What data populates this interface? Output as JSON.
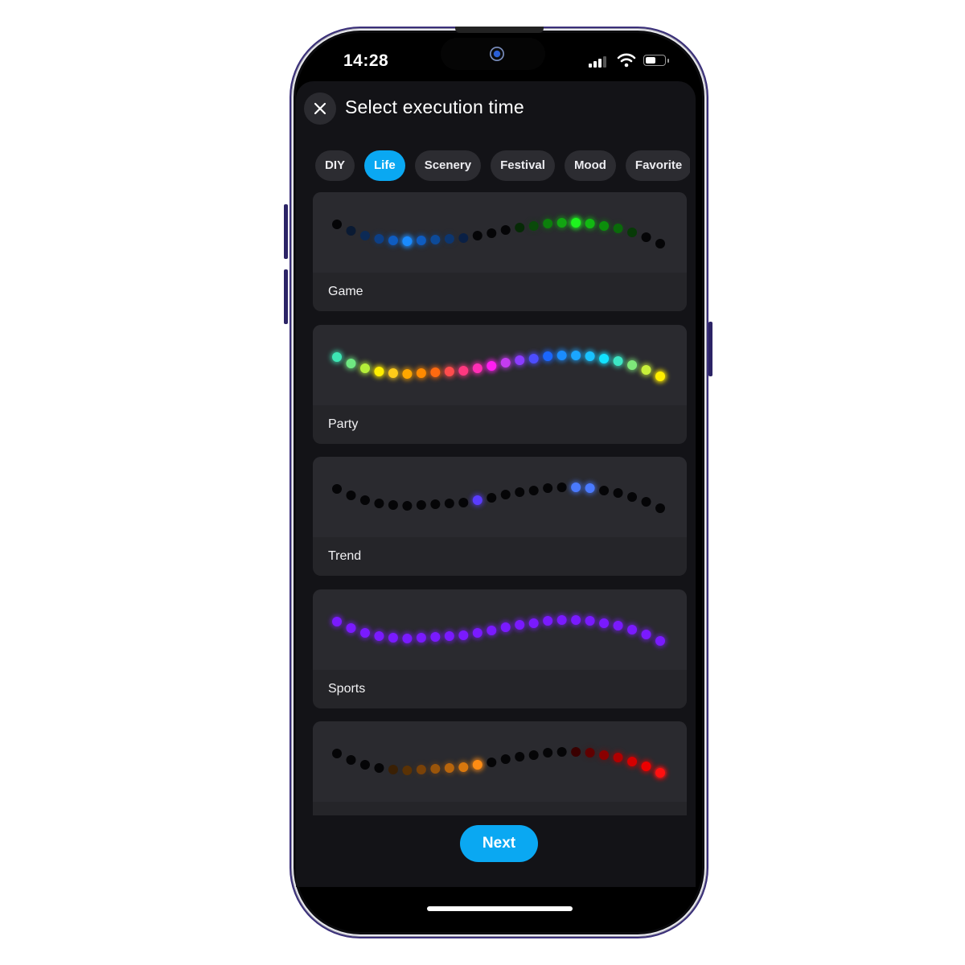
{
  "status_bar": {
    "time": "14:28",
    "signal_icon": "cellular-signal-icon",
    "wifi_icon": "wifi-icon",
    "battery_icon": "battery-icon",
    "battery_level": 0.55
  },
  "header": {
    "close_icon": "close-icon",
    "title": "Select execution time"
  },
  "tabs": [
    {
      "label": "DIY",
      "active": false
    },
    {
      "label": "Life",
      "active": true
    },
    {
      "label": "Scenery",
      "active": false
    },
    {
      "label": "Festival",
      "active": false
    },
    {
      "label": "Mood",
      "active": false
    },
    {
      "label": "Favorite",
      "active": false
    }
  ],
  "colors": {
    "accent": "#0aa8f2",
    "background": "#131317",
    "card": "#2a2a2f",
    "chip": "#2c2c31"
  },
  "effects": [
    {
      "label": "Game",
      "dots": [
        "#050507",
        "#0a1a33",
        "#0c2a55",
        "#0d3f85",
        "#0f5cc0",
        "#1a8bff",
        "#0f5cc0",
        "#0d4a98",
        "#0c3670",
        "#0a2045",
        "#050507",
        "#050507",
        "#050507",
        "#062a06",
        "#0a4a0a",
        "#0c7f0c",
        "#12a512",
        "#1ef51e",
        "#12b812",
        "#0c8f0c",
        "#0a6a0a",
        "#073a07",
        "#050507",
        "#050507"
      ],
      "glow": [
        0,
        0,
        0,
        0.3,
        0.5,
        0.9,
        0.5,
        0.3,
        0.2,
        0,
        0,
        0,
        0,
        0,
        0.2,
        0.4,
        0.6,
        0.9,
        0.6,
        0.4,
        0.2,
        0,
        0,
        0
      ]
    },
    {
      "label": "Party",
      "dots": [
        "#3de6b4",
        "#6fe882",
        "#b4ef3a",
        "#ffee00",
        "#ffcc1a",
        "#ffa600",
        "#ff8a00",
        "#ff6a10",
        "#ff4d4d",
        "#ff3880",
        "#ff2eb5",
        "#ff1ef0",
        "#c43cf0",
        "#8c3cff",
        "#4d4dff",
        "#1a66ff",
        "#1a8cff",
        "#1aa6ff",
        "#1ac2ff",
        "#12e2ff",
        "#3de6c4",
        "#7ee87a",
        "#c8ef3a",
        "#ffee00"
      ],
      "glow": [
        0.7,
        0.7,
        0.7,
        0.8,
        0.7,
        0.7,
        0.7,
        0.7,
        0.7,
        0.7,
        0.7,
        0.8,
        0.7,
        0.7,
        0.7,
        0.7,
        0.7,
        0.7,
        0.7,
        0.8,
        0.7,
        0.7,
        0.7,
        0.9
      ]
    },
    {
      "label": "Trend",
      "dots": [
        "#050507",
        "#050507",
        "#050507",
        "#050507",
        "#050507",
        "#050507",
        "#050507",
        "#050507",
        "#050507",
        "#050507",
        "#5a3cff",
        "#050507",
        "#050507",
        "#050507",
        "#050507",
        "#050507",
        "#050507",
        "#4a7aff",
        "#4a7aff",
        "#050507",
        "#050507",
        "#050507",
        "#050507",
        "#050507"
      ],
      "glow": [
        0,
        0,
        0,
        0,
        0,
        0,
        0,
        0,
        0,
        0,
        0.6,
        0,
        0,
        0,
        0,
        0,
        0,
        0.6,
        0.6,
        0,
        0,
        0,
        0,
        0
      ]
    },
    {
      "label": "Sports",
      "dots": [
        "#7a1aff",
        "#7a1aff",
        "#7a1aff",
        "#7a1aff",
        "#7a1aff",
        "#7a1aff",
        "#7a1aff",
        "#7a1aff",
        "#7a1aff",
        "#7a1aff",
        "#7a1aff",
        "#7a1aff",
        "#7a1aff",
        "#7a1aff",
        "#7a1aff",
        "#7a1aff",
        "#7a1aff",
        "#7a1aff",
        "#7a1aff",
        "#7a1aff",
        "#7a1aff",
        "#7a1aff",
        "#7a1aff",
        "#7a1aff"
      ],
      "glow": [
        0.6,
        0.6,
        0.6,
        0.6,
        0.6,
        0.6,
        0.6,
        0.6,
        0.6,
        0.6,
        0.6,
        0.6,
        0.6,
        0.6,
        0.6,
        0.6,
        0.6,
        0.6,
        0.6,
        0.6,
        0.6,
        0.6,
        0.6,
        0.6
      ]
    },
    {
      "label": "",
      "dots": [
        "#050507",
        "#050507",
        "#050507",
        "#050507",
        "#3a2005",
        "#5a3205",
        "#7a4208",
        "#9a550a",
        "#b8650c",
        "#d8780e",
        "#ff8c14",
        "#050507",
        "#050507",
        "#050507",
        "#050507",
        "#050507",
        "#050507",
        "#3a0000",
        "#600000",
        "#8a0000",
        "#b00000",
        "#d40000",
        "#ec0000",
        "#ff1010"
      ],
      "glow": [
        0,
        0,
        0,
        0,
        0,
        0.1,
        0.2,
        0.3,
        0.4,
        0.5,
        0.8,
        0,
        0,
        0,
        0,
        0,
        0,
        0,
        0.2,
        0.3,
        0.5,
        0.6,
        0.7,
        0.9
      ]
    }
  ],
  "footer": {
    "next_label": "Next"
  }
}
